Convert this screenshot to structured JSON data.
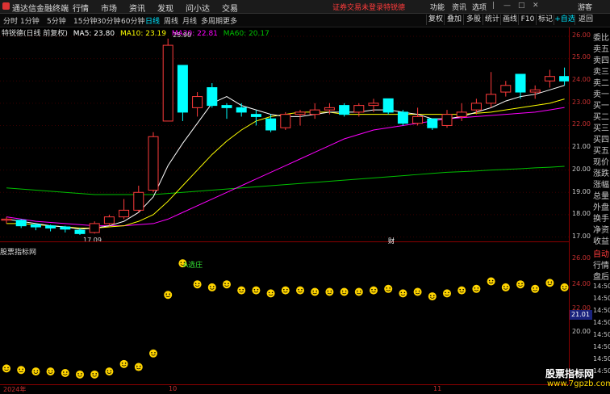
{
  "app": {
    "title": "通达信金融终端"
  },
  "menu": [
    "行情",
    "市场",
    "资讯",
    "发现",
    "问小达",
    "交易"
  ],
  "alert": "证券交易未登录",
  "stock_name": "特锐德",
  "right_menu": [
    "功能",
    "资讯",
    "选项"
  ],
  "user": "游客",
  "periods": [
    "分时",
    "1分钟",
    "5分钟",
    "15分钟",
    "30分钟",
    "60分钟",
    "日线",
    "周线",
    "月线",
    "多周期",
    "更多"
  ],
  "active_period": "日线",
  "toolbar_right": [
    "复权",
    "叠加",
    "多股",
    "统计",
    "画线",
    "F10",
    "标记",
    "+自选",
    "返回"
  ],
  "chart_header": {
    "name": "特锐德(日线 前复权)",
    "ma5": "MA5: 23.80",
    "ma10": "MA10: 23.19",
    "ma20": "MA20: 22.81",
    "ma60": "MA60: 20.17"
  },
  "indicator_title": "股票指标网",
  "right_panel": [
    "委比",
    "卖五",
    "卖四",
    "卖三",
    "卖二",
    "卖一",
    "买一",
    "买二",
    "买三",
    "买四",
    "买五",
    "现价",
    "涨跌",
    "涨幅",
    "总量",
    "外盘",
    "换手",
    "净资",
    "收益",
    "自动",
    "行情",
    "盘后",
    "14:50",
    "14:50",
    "14:50",
    "14:50",
    "14:50",
    "14:50",
    "14:50",
    "14:50"
  ],
  "y_axis_main": [
    "26.00",
    "25.00",
    "24.00",
    "23.00",
    "22.00",
    "21.00",
    "20.00",
    "19.00",
    "18.00",
    "17.00"
  ],
  "y_axis_ind": [
    "26.00",
    "24.00",
    "22.00",
    "20.00"
  ],
  "y_marker": "21.01",
  "x_axis": [
    "2024年",
    "10",
    "11"
  ],
  "cai_label": "财",
  "high_label": "25.90",
  "low_label": "17.09",
  "annotation": "A选庄",
  "watermark": {
    "line1": "股票指标网",
    "line2": "www.7gpzb.com"
  },
  "colors": {
    "up": "#ff3b3b",
    "down": "#00ffff",
    "ma5": "#ffffff",
    "ma10": "#ffff00",
    "ma20": "#ff00ff",
    "ma60": "#00c000",
    "smile": "#ffd400"
  },
  "chart_data": {
    "type": "candlestick",
    "ylim": [
      16.8,
      26.4
    ],
    "candles": [
      {
        "o": 17.75,
        "c": 17.8,
        "h": 17.9,
        "l": 17.6
      },
      {
        "o": 17.75,
        "c": 17.5,
        "h": 17.8,
        "l": 17.4
      },
      {
        "o": 17.55,
        "c": 17.45,
        "h": 17.6,
        "l": 17.3
      },
      {
        "o": 17.5,
        "c": 17.4,
        "h": 17.55,
        "l": 17.25
      },
      {
        "o": 17.45,
        "c": 17.35,
        "h": 17.5,
        "l": 17.2
      },
      {
        "o": 17.3,
        "c": 17.15,
        "h": 17.4,
        "l": 17.09
      },
      {
        "o": 17.2,
        "c": 17.6,
        "h": 17.7,
        "l": 17.15
      },
      {
        "o": 17.6,
        "c": 17.9,
        "h": 18.0,
        "l": 17.5
      },
      {
        "o": 17.9,
        "c": 18.2,
        "h": 18.7,
        "l": 17.8
      },
      {
        "o": 18.2,
        "c": 19.0,
        "h": 19.3,
        "l": 18.1
      },
      {
        "o": 19.1,
        "c": 21.5,
        "h": 21.7,
        "l": 19.0
      },
      {
        "o": 22.2,
        "c": 25.6,
        "h": 25.9,
        "l": 22.5
      },
      {
        "o": 24.7,
        "c": 22.6,
        "h": 24.7,
        "l": 22.2
      },
      {
        "o": 22.8,
        "c": 23.3,
        "h": 23.5,
        "l": 22.4
      },
      {
        "o": 23.7,
        "c": 22.9,
        "h": 23.9,
        "l": 22.8
      },
      {
        "o": 22.9,
        "c": 22.8,
        "h": 23.0,
        "l": 22.3
      },
      {
        "o": 22.8,
        "c": 22.6,
        "h": 23.0,
        "l": 22.4
      },
      {
        "o": 22.5,
        "c": 22.4,
        "h": 22.7,
        "l": 22.0
      },
      {
        "o": 22.3,
        "c": 21.8,
        "h": 22.5,
        "l": 21.7
      },
      {
        "o": 21.9,
        "c": 22.5,
        "h": 22.6,
        "l": 21.8
      },
      {
        "o": 22.5,
        "c": 22.6,
        "h": 22.7,
        "l": 22.0
      },
      {
        "o": 22.5,
        "c": 22.7,
        "h": 23.0,
        "l": 22.3
      },
      {
        "o": 22.7,
        "c": 22.8,
        "h": 23.0,
        "l": 22.5
      },
      {
        "o": 22.9,
        "c": 22.5,
        "h": 23.0,
        "l": 22.4
      },
      {
        "o": 22.6,
        "c": 22.9,
        "h": 23.0,
        "l": 22.4
      },
      {
        "o": 22.9,
        "c": 23.0,
        "h": 23.2,
        "l": 22.6
      },
      {
        "o": 23.2,
        "c": 22.6,
        "h": 23.2,
        "l": 22.5
      },
      {
        "o": 22.6,
        "c": 22.1,
        "h": 22.7,
        "l": 22.0
      },
      {
        "o": 22.1,
        "c": 22.4,
        "h": 22.8,
        "l": 22.0
      },
      {
        "o": 22.3,
        "c": 21.9,
        "h": 22.3,
        "l": 21.8
      },
      {
        "o": 22.0,
        "c": 22.5,
        "h": 22.7,
        "l": 21.9
      },
      {
        "o": 22.4,
        "c": 22.6,
        "h": 23.0,
        "l": 22.2
      },
      {
        "o": 22.7,
        "c": 23.0,
        "h": 23.2,
        "l": 22.5
      },
      {
        "o": 23.0,
        "c": 23.4,
        "h": 24.4,
        "l": 22.8
      },
      {
        "o": 23.5,
        "c": 23.8,
        "h": 24.0,
        "l": 23.3
      },
      {
        "o": 24.3,
        "c": 23.5,
        "h": 24.3,
        "l": 23.2
      },
      {
        "o": 23.5,
        "c": 23.6,
        "h": 23.8,
        "l": 23.2
      },
      {
        "o": 24.0,
        "c": 24.2,
        "h": 24.5,
        "l": 23.7
      },
      {
        "o": 24.2,
        "c": 24.0,
        "h": 24.6,
        "l": 23.8
      }
    ],
    "ma5": [
      17.8,
      17.7,
      17.6,
      17.5,
      17.45,
      17.35,
      17.4,
      17.5,
      17.7,
      18.1,
      18.8,
      20.2,
      21.2,
      22.1,
      23.0,
      23.3,
      22.9,
      22.7,
      22.5,
      22.4,
      22.4,
      22.5,
      22.6,
      22.6,
      22.6,
      22.7,
      22.7,
      22.6,
      22.5,
      22.3,
      22.3,
      22.4,
      22.6,
      22.8,
      23.1,
      23.3,
      23.4,
      23.6,
      23.8
    ],
    "ma10": [
      17.6,
      17.6,
      17.55,
      17.5,
      17.45,
      17.4,
      17.4,
      17.45,
      17.5,
      17.7,
      18.0,
      18.6,
      19.3,
      20.0,
      20.7,
      21.3,
      21.8,
      22.2,
      22.4,
      22.5,
      22.6,
      22.6,
      22.6,
      22.5,
      22.5,
      22.5,
      22.5,
      22.5,
      22.5,
      22.5,
      22.5,
      22.5,
      22.55,
      22.6,
      22.7,
      22.8,
      22.9,
      23.0,
      23.19
    ],
    "ma20": [
      17.9,
      17.8,
      17.7,
      17.65,
      17.6,
      17.55,
      17.5,
      17.5,
      17.5,
      17.55,
      17.6,
      17.8,
      18.1,
      18.4,
      18.7,
      19.0,
      19.3,
      19.6,
      19.9,
      20.2,
      20.5,
      20.8,
      21.1,
      21.4,
      21.6,
      21.8,
      21.9,
      22.0,
      22.1,
      22.2,
      22.3,
      22.35,
      22.4,
      22.45,
      22.5,
      22.55,
      22.6,
      22.7,
      22.81
    ],
    "ma60": [
      19.2,
      19.15,
      19.1,
      19.05,
      19.0,
      18.95,
      18.9,
      18.9,
      18.9,
      18.9,
      18.9,
      18.95,
      19.0,
      19.05,
      19.1,
      19.15,
      19.2,
      19.25,
      19.3,
      19.35,
      19.4,
      19.45,
      19.5,
      19.55,
      19.6,
      19.65,
      19.7,
      19.75,
      19.8,
      19.85,
      19.9,
      19.93,
      19.96,
      20.0,
      20.03,
      20.06,
      20.1,
      20.13,
      20.17
    ],
    "indicator_ylim": [
      18.2,
      26.8
    ],
    "indicator": [
      19.2,
      19.1,
      19.0,
      19.0,
      18.9,
      18.8,
      18.8,
      19.0,
      19.5,
      19.3,
      20.2,
      24.1,
      26.2,
      24.8,
      24.6,
      24.8,
      24.4,
      24.4,
      24.2,
      24.4,
      24.4,
      24.3,
      24.3,
      24.3,
      24.3,
      24.4,
      24.5,
      24.2,
      24.3,
      24.0,
      24.2,
      24.4,
      24.5,
      25.0,
      24.6,
      24.8,
      24.5,
      24.9,
      24.6
    ]
  }
}
